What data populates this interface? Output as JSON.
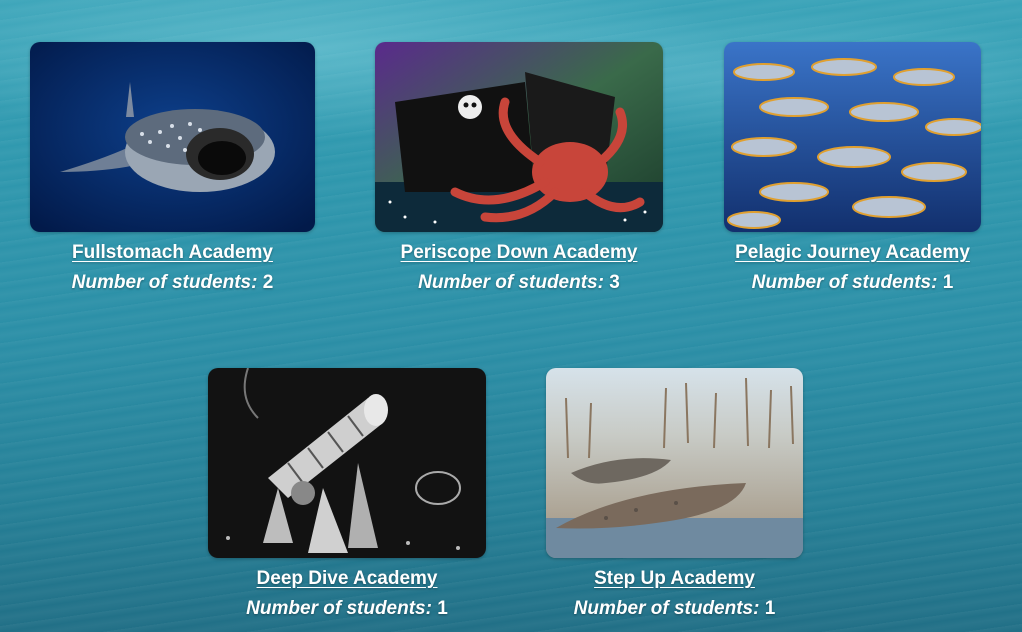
{
  "students_label": "Number of students:",
  "academies": [
    {
      "name": "Fullstomach Academy",
      "students": "2",
      "image": "whale-shark-image"
    },
    {
      "name": "Periscope Down Academy",
      "students": "3",
      "image": "pirate-ship-octopus-image"
    },
    {
      "name": "Pelagic Journey Academy",
      "students": "1",
      "image": "tuna-school-image"
    },
    {
      "name": "Deep Dive Academy",
      "students": "1",
      "image": "submarine-illustration-image"
    },
    {
      "name": "Step Up Academy",
      "students": "1",
      "image": "prehistoric-fish-image"
    }
  ]
}
